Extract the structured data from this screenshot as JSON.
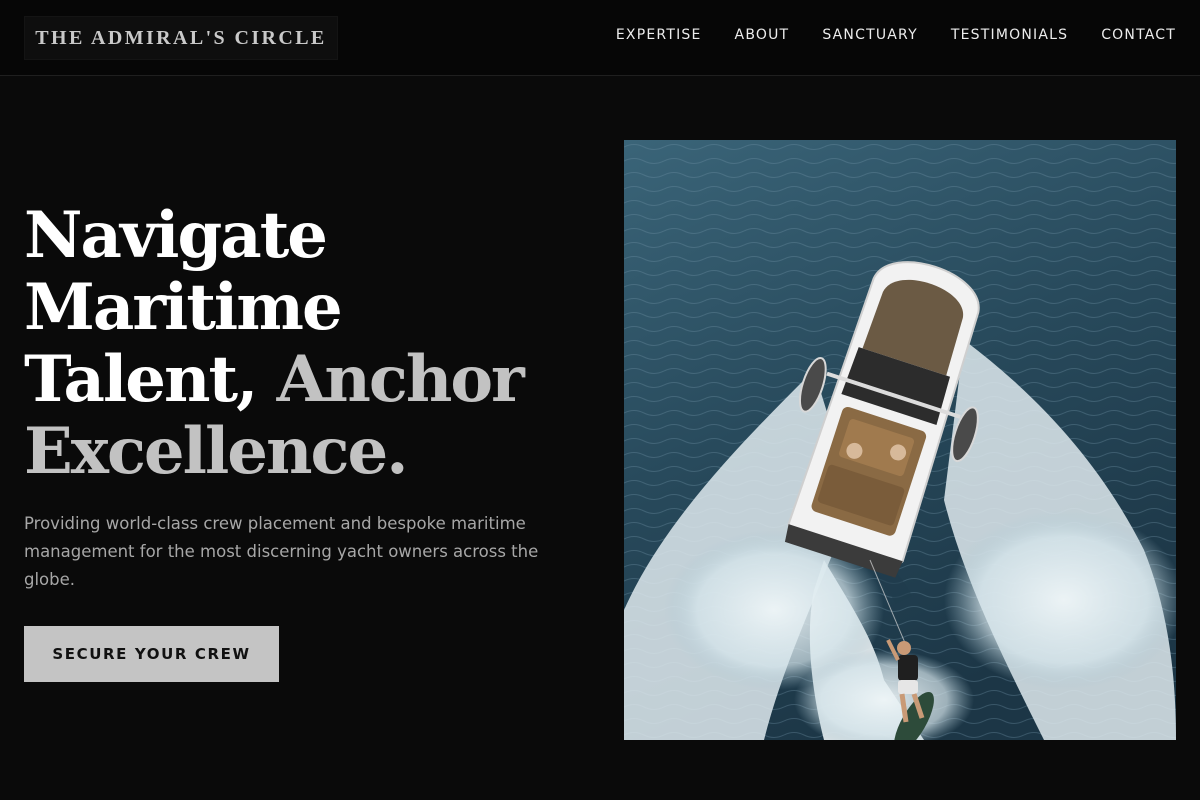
{
  "brand": {
    "name": "THE ADMIRAL'S CIRCLE"
  },
  "nav": {
    "items": [
      {
        "label": "EXPERTISE"
      },
      {
        "label": "ABOUT"
      },
      {
        "label": "SANCTUARY"
      },
      {
        "label": "TESTIMONIALS"
      },
      {
        "label": "CONTACT"
      }
    ]
  },
  "hero": {
    "title_line1": "Navigate",
    "title_line2": "Maritime",
    "title_line3_main": "Talent,",
    "title_line3_accent": "Anchor",
    "title_line4_accent": "Excellence.",
    "subtitle": "Providing world-class crew placement and bespoke maritime management for the most discerning yacht owners across the globe.",
    "cta_label": "SECURE YOUR CREW",
    "image": {
      "description_icon": "aerial-speedboat-wakeboarder-photo"
    }
  },
  "colors": {
    "background": "#0a0a0a",
    "nav_background": "#060606",
    "title_primary": "#ffffff",
    "title_accent": "#c2c2c2",
    "subtitle": "#a7a7a7",
    "cta_background": "#c4c4c4",
    "cta_text": "#111111"
  }
}
